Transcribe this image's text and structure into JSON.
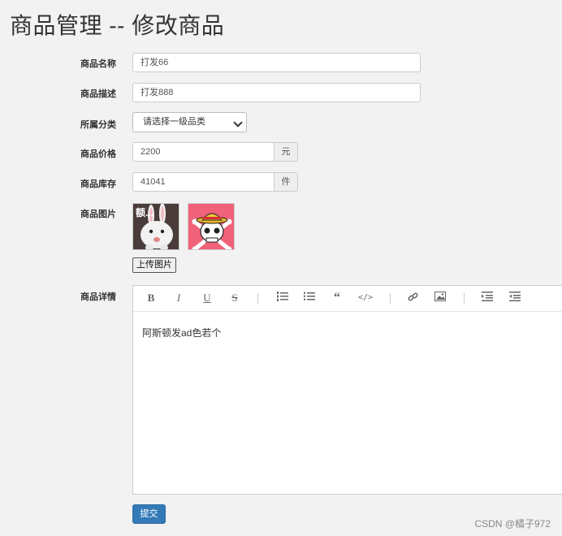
{
  "page": {
    "title": "商品管理 -- 修改商品"
  },
  "form": {
    "name": {
      "label": "商品名称",
      "value": "打发66"
    },
    "desc": {
      "label": "商品描述",
      "value": "打发888"
    },
    "category": {
      "label": "所属分类",
      "selected": "请选择一级品类"
    },
    "price": {
      "label": "商品价格",
      "value": "2200",
      "unit": "元"
    },
    "stock": {
      "label": "商品库存",
      "value": "41041",
      "unit": "件"
    },
    "images": {
      "label": "商品图片",
      "upload_label": "上传图片",
      "items": [
        {
          "icon": "rabbit-image",
          "caption": "额..."
        },
        {
          "icon": "skull-pirate-image"
        }
      ]
    },
    "detail": {
      "label": "商品详情",
      "content": "阿斯顿发ad色若个"
    },
    "submit_label": "提交"
  },
  "editor_toolbar": [
    "bold-icon",
    "italic-icon",
    "underline-icon",
    "strikethrough-icon",
    "ordered-list-icon",
    "unordered-list-icon",
    "quote-icon",
    "code-icon",
    "link-icon",
    "image-icon",
    "indent-icon",
    "outdent-icon"
  ],
  "watermark": "CSDN @橘子972",
  "colors": {
    "primary": "#337ab7",
    "background": "#f2f2f2"
  }
}
